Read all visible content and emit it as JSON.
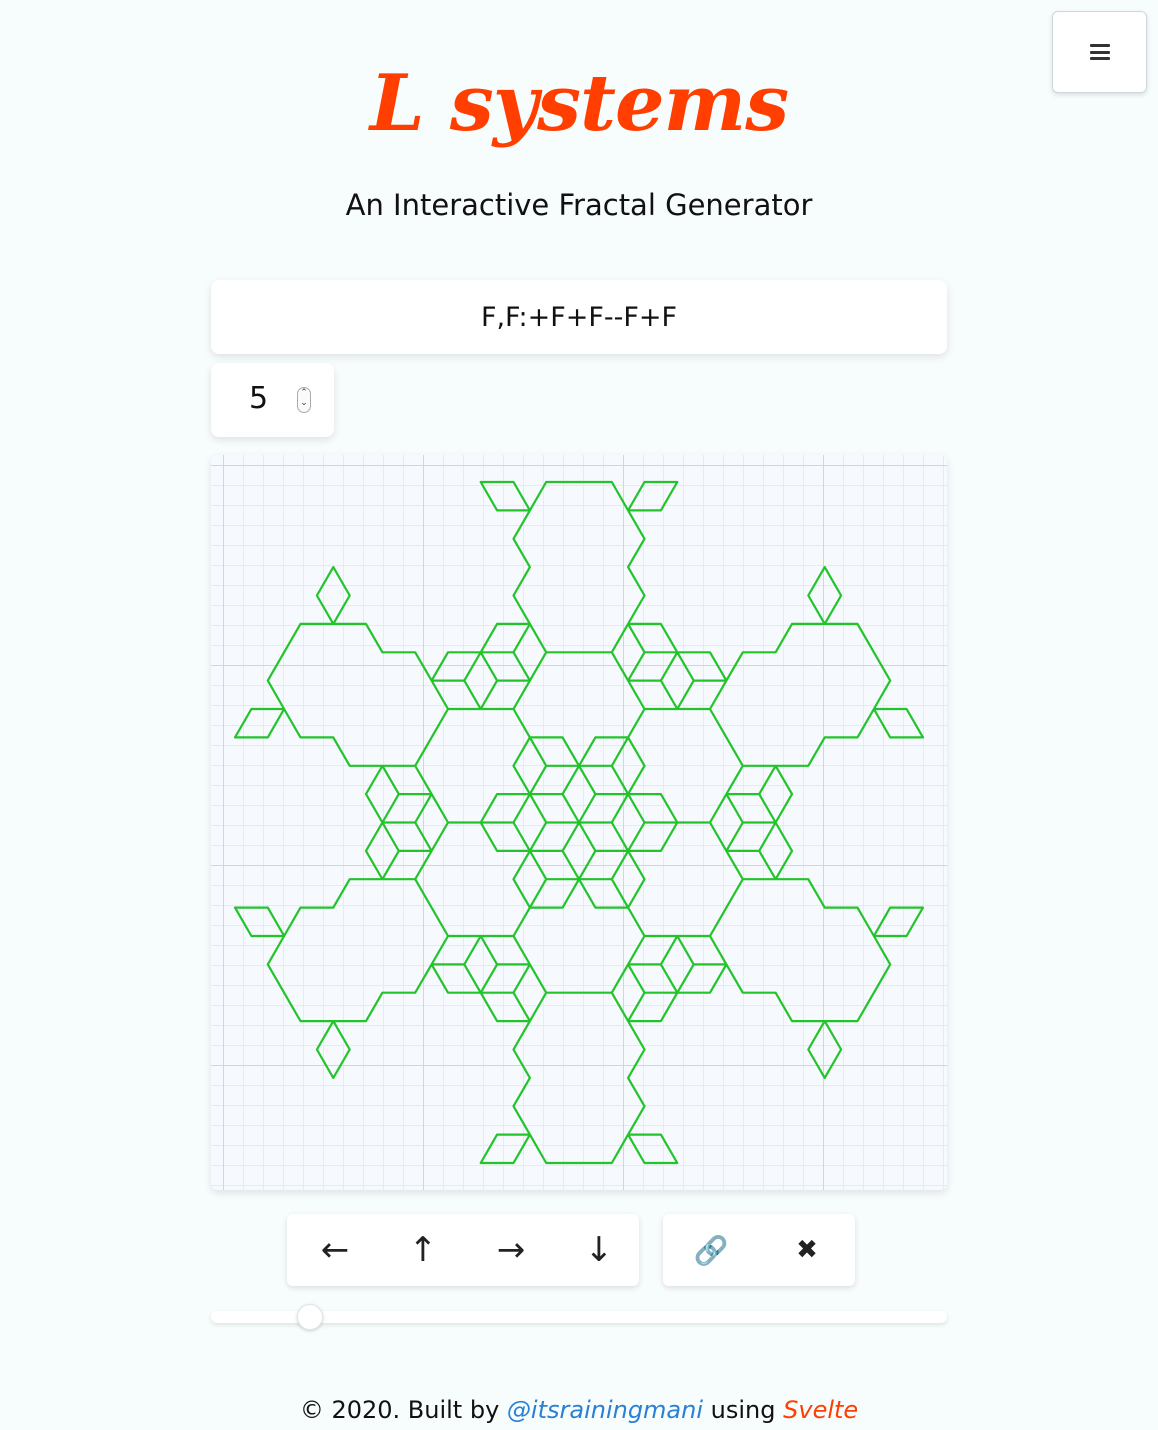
{
  "header": {
    "title": "L systems",
    "subtitle": "An Interactive Fractal Generator",
    "menu_icon": "hamburger-menu-icon"
  },
  "controls": {
    "rule": "F,F:+F+F--F+F",
    "iterations": "5",
    "spinner_up": "⌃",
    "spinner_down": "⌄"
  },
  "canvas": {
    "stroke_color": "#22c42a",
    "grid_color": "#c5d7f5",
    "axiom": "F",
    "production": "+F+F--F+F",
    "angle_degrees": 60,
    "iterations": 5
  },
  "pan_buttons": {
    "left": "←",
    "up": "↑",
    "right": "→",
    "down": "↓"
  },
  "action_buttons": {
    "link": "🔗",
    "clear": "✖"
  },
  "slider": {
    "value_fraction": 0.135
  },
  "footer": {
    "copyright": "© 2020. Built by",
    "author": "@itsrainingmani",
    "using": "using",
    "framework": "Svelte"
  },
  "colors": {
    "brand": "#ff3e00",
    "link": "#2980d4",
    "background": "#f7fcfc"
  }
}
